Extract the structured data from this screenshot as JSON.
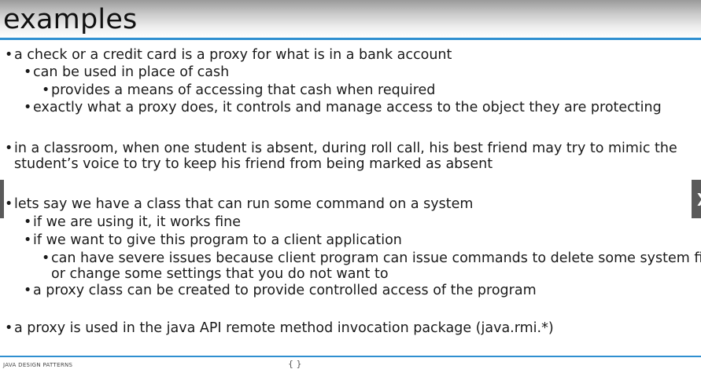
{
  "slide": {
    "title": "examples"
  },
  "bullet_glyph": "•",
  "bullets": [
    {
      "text": "a check or a credit card is a proxy for what is in a bank account"
    },
    {
      "text": "can be used in place of cash"
    },
    {
      "text": "provides a means of accessing that cash when required"
    },
    {
      "text": "exactly what a proxy does, it controls and manage access to the object they are protecting"
    },
    {
      "text": "in a classroom, when one student is absent, during roll call, his best friend may try to mimic the",
      "cont": "student’s voice to try to keep his friend from being marked as absent"
    },
    {
      "text": "lets say we have a class that can run some command on a system"
    },
    {
      "text": "if we are using it, it works fine"
    },
    {
      "text": "if we want to give this program to a client application"
    },
    {
      "text": "can have severe issues because client program can issue commands to delete some system files",
      "cont": "or change some settings that you do not want to"
    },
    {
      "text": "a proxy class can be created to provide controlled access of the program"
    },
    {
      "text": "a proxy is used in the java API remote method invocation package (java.rmi.*)"
    }
  ],
  "footer": {
    "label": "JAVA DESIGN PATTERNS",
    "glyph": "{ }"
  },
  "nav": {
    "next_glyph": "❯"
  },
  "colors": {
    "accent": "#2f8fd0",
    "nav": "#5a5a5a"
  }
}
